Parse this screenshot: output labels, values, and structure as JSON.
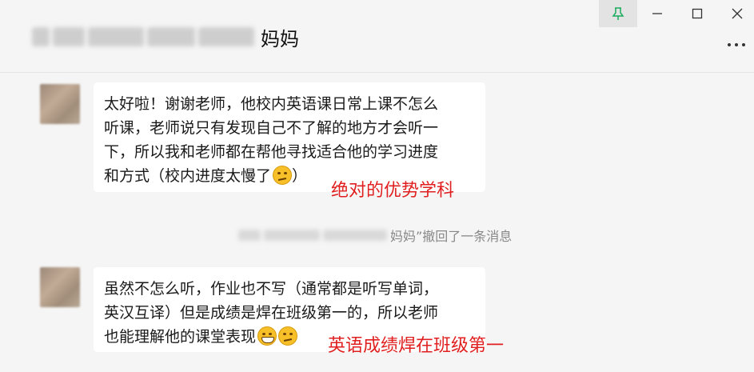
{
  "window": {
    "title": "妈妈",
    "pin_icon": "pin-icon",
    "minimize_icon": "minimize-icon",
    "maximize_icon": "maximize-icon",
    "close_icon": "close-icon",
    "more_icon": "more-icon",
    "accent_color": "#07c160"
  },
  "messages": [
    {
      "lines": [
        "太好啦！谢谢老师，他校内英语课日常上课不怎么",
        "听课，老师说只有发现自己不了解的地方才会听一",
        "下，所以我和老师都在帮他寻找适合他的学习进度",
        "和方式（校内进度太慢了"
      ],
      "tail": "）",
      "annotation": "绝对的优势学科"
    },
    {
      "lines": [
        "虽然不怎么听，作业也不写（通常都是听写单词，",
        "英汉互译）但是成绩是焊在班级第一的，所以老师",
        "也能理解他的课堂表现"
      ],
      "annotation": "英语成绩焊在班级第一"
    }
  ],
  "recall": {
    "name": "妈妈”",
    "text": " 撤回了一条消息"
  },
  "annotation_color": "#e02020"
}
